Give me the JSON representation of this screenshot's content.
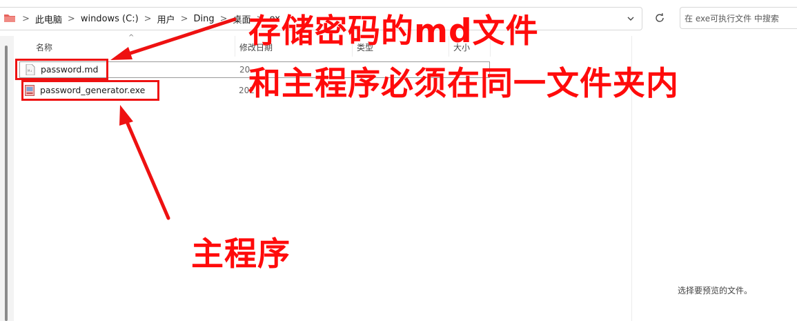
{
  "addressbar": {
    "crumbs": [
      "此电脑",
      "windows (C:)",
      "用户",
      "Ding",
      "桌面",
      "ex"
    ],
    "separator": ">"
  },
  "search": {
    "placeholder": "在 exe可执行文件 中搜索"
  },
  "columns": {
    "name": "名称",
    "modified": "修改日期",
    "type": "类型",
    "size": "大小"
  },
  "files": [
    {
      "name": "password.md",
      "modified": "20",
      "type": "",
      "size": ""
    },
    {
      "name": "password_generator.exe",
      "modified": "202",
      "type": "",
      "size": ""
    }
  ],
  "preview": {
    "empty_text": "选择要预览的文件。"
  },
  "annotations": {
    "line1": "存储密码的md文件",
    "line2": "和主程序必须在同一文件夹内",
    "line3": "主程序",
    "color": "#ff0b0b"
  }
}
